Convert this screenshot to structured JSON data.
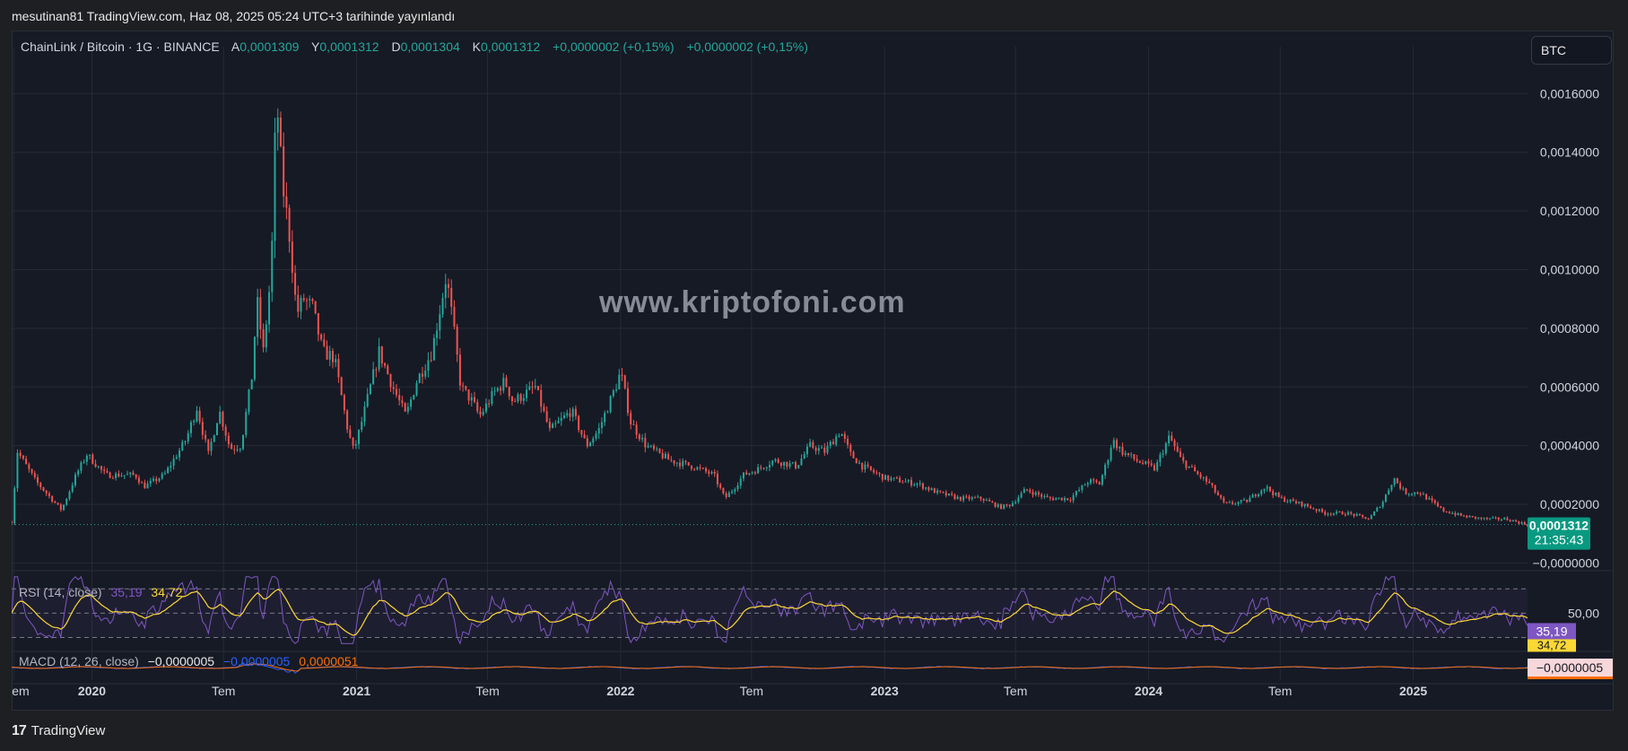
{
  "publish_line": "mesutinan81 TradingView.com, Haz 08, 2025 05:24 UTC+3 tarihinde yayınlandı",
  "legend": {
    "symbol": "ChainLink / Bitcoin · 1G · BINANCE",
    "open_k": "A",
    "open": "0,0001309",
    "high_k": "Y",
    "high": "0,0001312",
    "low_k": "D",
    "low": "0,0001304",
    "close_k": "K",
    "close": "0,0001312",
    "change1": "+0,0000002 (+0,15%)",
    "change2": "+0,0000002 (+0,15%)"
  },
  "symbol_button": "BTC",
  "watermark": "www.kriptofoni.com",
  "rsi_legend": {
    "label": "RSI (14, close)",
    "rsi": "35,19",
    "ma": "34,72"
  },
  "macd_legend": {
    "label": "MACD (12, 26, close)",
    "macd": "−0,0000005",
    "signal": "−0,0000005",
    "hist": "0,0000051"
  },
  "footer": {
    "logo_mark": "17",
    "logo_text": "TradingView"
  },
  "colors": {
    "up": "#26a69a",
    "down": "#ef5350",
    "rsi": "#7e57c2",
    "rsi_ma": "#fdd835",
    "macd": "#2962ff",
    "signal": "#ff6d00",
    "text": "#d1d4dc",
    "grid": "#252a36"
  },
  "chart_data": {
    "type": "candlestick",
    "title": "ChainLink / Bitcoin · 1G · BINANCE",
    "price_axis": {
      "ticks": [
        "0,0016000",
        "0,0014000",
        "0,0012000",
        "0,0010000",
        "0,0008000",
        "0,0006000",
        "0,0004000",
        "0,0002000",
        "−0,0000000"
      ],
      "tick_values": [
        0.0016,
        0.0014,
        0.0012,
        0.001,
        0.0008,
        0.0006,
        0.0004,
        0.0002,
        0.0
      ],
      "ylim": [
        -2e-05,
        0.00176
      ]
    },
    "last_price_label": {
      "value": "0,0001312",
      "countdown": "21:35:43",
      "price": 0.0001312
    },
    "time_axis": {
      "ticks": [
        "em",
        "2020",
        "Tem",
        "2021",
        "Tem",
        "2022",
        "Tem",
        "2023",
        "Tem",
        "2024",
        "Tem",
        "2025"
      ],
      "tick_dates": [
        "2019-09-15",
        "2020-01-01",
        "2020-07-01",
        "2021-01-01",
        "2021-07-01",
        "2022-01-01",
        "2022-07-01",
        "2023-01-01",
        "2023-07-01",
        "2024-01-01",
        "2024-07-01",
        "2025-01-01"
      ],
      "xlim": [
        "2019-09-12",
        "2025-06-08"
      ]
    },
    "anchors": [
      [
        "2019-09-12",
        0.00014
      ],
      [
        "2019-09-20",
        0.00038
      ],
      [
        "2019-10-15",
        0.00028
      ],
      [
        "2019-11-20",
        0.00018
      ],
      [
        "2019-12-10",
        0.0003
      ],
      [
        "2019-12-25",
        0.00037
      ],
      [
        "2020-01-20",
        0.0003
      ],
      [
        "2020-03-01",
        0.0003
      ],
      [
        "2020-03-13",
        0.00026
      ],
      [
        "2020-04-10",
        0.0003
      ],
      [
        "2020-05-10",
        0.00042
      ],
      [
        "2020-05-25",
        0.00053
      ],
      [
        "2020-06-10",
        0.00037
      ],
      [
        "2020-06-25",
        0.00052
      ],
      [
        "2020-07-10",
        0.00039
      ],
      [
        "2020-07-25",
        0.0004
      ],
      [
        "2020-08-10",
        0.00065
      ],
      [
        "2020-08-16",
        0.0009
      ],
      [
        "2020-08-25",
        0.00072
      ],
      [
        "2020-09-05",
        0.001
      ],
      [
        "2020-09-12",
        0.0016
      ],
      [
        "2020-09-20",
        0.0013
      ],
      [
        "2020-10-01",
        0.0011
      ],
      [
        "2020-10-10",
        0.00085
      ],
      [
        "2020-10-20",
        0.0009
      ],
      [
        "2020-11-01",
        0.00087
      ],
      [
        "2020-11-15",
        0.00072
      ],
      [
        "2020-12-01",
        0.0007
      ],
      [
        "2020-12-20",
        0.00045
      ],
      [
        "2020-12-28",
        0.00038
      ],
      [
        "2021-01-10",
        0.0005
      ],
      [
        "2021-02-01",
        0.00072
      ],
      [
        "2021-02-20",
        0.0006
      ],
      [
        "2021-03-10",
        0.0005
      ],
      [
        "2021-03-25",
        0.00062
      ],
      [
        "2021-04-15",
        0.00072
      ],
      [
        "2021-05-05",
        0.00098
      ],
      [
        "2021-05-15",
        0.0008
      ],
      [
        "2021-05-25",
        0.0006
      ],
      [
        "2021-06-10",
        0.00055
      ],
      [
        "2021-06-20",
        0.0005
      ],
      [
        "2021-07-10",
        0.00058
      ],
      [
        "2021-07-25",
        0.00062
      ],
      [
        "2021-08-05",
        0.00055
      ],
      [
        "2021-09-05",
        0.0006
      ],
      [
        "2021-09-25",
        0.00045
      ],
      [
        "2021-10-25",
        0.00052
      ],
      [
        "2021-11-15",
        0.0004
      ],
      [
        "2021-12-01",
        0.00045
      ],
      [
        "2021-12-25",
        0.0006
      ],
      [
        "2022-01-01",
        0.00065
      ],
      [
        "2022-01-15",
        0.00048
      ],
      [
        "2022-02-05",
        0.0004
      ],
      [
        "2022-03-10",
        0.00035
      ],
      [
        "2022-04-10",
        0.00033
      ],
      [
        "2022-05-10",
        0.0003
      ],
      [
        "2022-05-25",
        0.00022
      ],
      [
        "2022-06-05",
        0.00025
      ],
      [
        "2022-06-20",
        0.0003
      ],
      [
        "2022-07-10",
        0.00032
      ],
      [
        "2022-08-01",
        0.00035
      ],
      [
        "2022-09-01",
        0.00033
      ],
      [
        "2022-09-20",
        0.0004
      ],
      [
        "2022-10-10",
        0.00038
      ],
      [
        "2022-11-01",
        0.00045
      ],
      [
        "2022-11-15",
        0.00037
      ],
      [
        "2022-12-01",
        0.00033
      ],
      [
        "2023-01-01",
        0.00029
      ],
      [
        "2023-02-15",
        0.00027
      ],
      [
        "2023-03-15",
        0.00024
      ],
      [
        "2023-04-15",
        0.00022
      ],
      [
        "2023-05-15",
        0.00022
      ],
      [
        "2023-06-10",
        0.00019
      ],
      [
        "2023-06-25",
        0.0002
      ],
      [
        "2023-07-15",
        0.00025
      ],
      [
        "2023-08-15",
        0.00022
      ],
      [
        "2023-09-15",
        0.00022
      ],
      [
        "2023-10-10",
        0.00028
      ],
      [
        "2023-10-25",
        0.00027
      ],
      [
        "2023-11-05",
        0.00035
      ],
      [
        "2023-11-12",
        0.00042
      ],
      [
        "2023-11-25",
        0.00038
      ],
      [
        "2023-12-15",
        0.00035
      ],
      [
        "2024-01-10",
        0.00032
      ],
      [
        "2024-01-20",
        0.00038
      ],
      [
        "2024-01-30",
        0.00043
      ],
      [
        "2024-02-15",
        0.00035
      ],
      [
        "2024-03-10",
        0.0003
      ],
      [
        "2024-03-25",
        0.00027
      ],
      [
        "2024-04-15",
        0.0002
      ],
      [
        "2024-05-15",
        0.00021
      ],
      [
        "2024-06-10",
        0.00026
      ],
      [
        "2024-07-01",
        0.00022
      ],
      [
        "2024-08-01",
        0.0002
      ],
      [
        "2024-09-01",
        0.00017
      ],
      [
        "2024-10-01",
        0.00017
      ],
      [
        "2024-11-01",
        0.00015
      ],
      [
        "2024-11-20",
        0.00021
      ],
      [
        "2024-12-05",
        0.00029
      ],
      [
        "2024-12-20",
        0.00024
      ],
      [
        "2025-01-10",
        0.00024
      ],
      [
        "2025-02-10",
        0.00018
      ],
      [
        "2025-03-10",
        0.00016
      ],
      [
        "2025-04-10",
        0.00015
      ],
      [
        "2025-05-10",
        0.00015
      ],
      [
        "2025-06-08",
        0.00013
      ]
    ],
    "rsi": {
      "name": "RSI (14, close)",
      "last": 35.19,
      "ma_last": 34.72,
      "bands": [
        30,
        50,
        70
      ],
      "labels": [
        "50,00",
        "35,19",
        "34,72"
      ]
    },
    "macd": {
      "name": "MACD (12, 26, close)",
      "last": -5e-07,
      "labels": [
        "−0,0000005"
      ]
    }
  }
}
